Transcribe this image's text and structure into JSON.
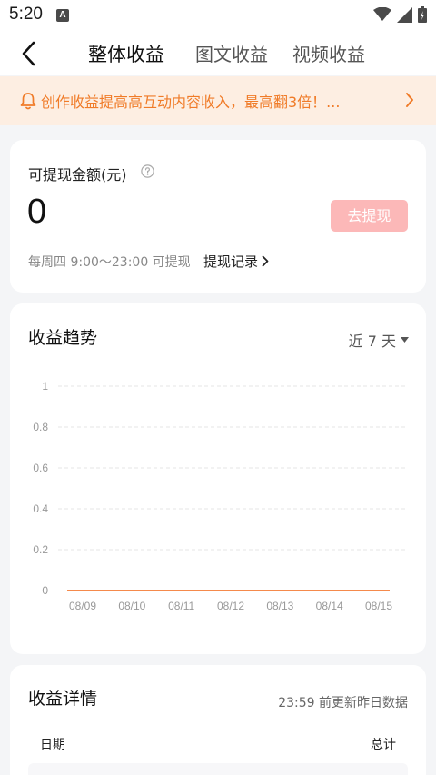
{
  "status": {
    "time": "5:20",
    "notif_letter": "A"
  },
  "nav": {
    "tabs": [
      {
        "label": "整体收益",
        "active": true
      },
      {
        "label": "图文收益",
        "active": false
      },
      {
        "label": "视频收益",
        "active": false
      }
    ]
  },
  "banner": {
    "text": "创作收益提高高互动内容收入，最高翻3倍！..."
  },
  "withdraw": {
    "label": "可提现金额(元)",
    "amount": "0",
    "button": "去提现",
    "schedule": "每周四 9:00～23:00 可提现",
    "records_link": "提现记录"
  },
  "trend": {
    "title": "收益趋势",
    "range": "近 7 天"
  },
  "chart_data": {
    "type": "line",
    "x": [
      "08/09",
      "08/10",
      "08/11",
      "08/12",
      "08/13",
      "08/14",
      "08/15"
    ],
    "series": [
      {
        "values": [
          0,
          0,
          0,
          0,
          0,
          0,
          0
        ]
      }
    ],
    "yticks": [
      "0",
      "0.2",
      "0.4",
      "0.6",
      "0.8",
      "1"
    ],
    "ylim": [
      0,
      1
    ],
    "grid": true,
    "line_color": "#f58a4c"
  },
  "details": {
    "title": "收益详情",
    "note": "23:59 前更新昨日数据",
    "columns": {
      "date": "日期",
      "total": "总计"
    }
  },
  "colors": {
    "accent": "#f07b28",
    "banner_bg": "#fdeee2",
    "button_disabled": "#fcb8b8"
  }
}
